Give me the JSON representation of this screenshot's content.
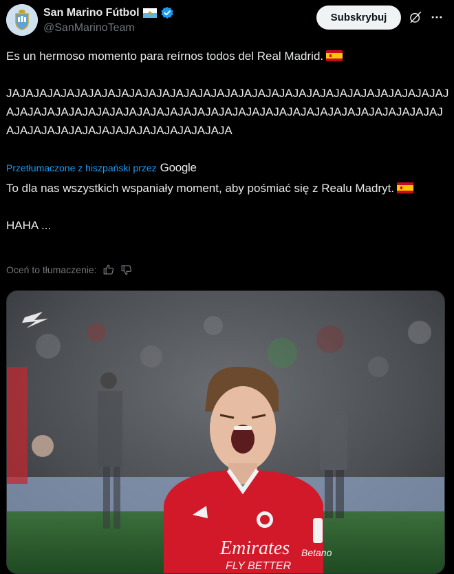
{
  "account": {
    "name": "San Marino Fútbol",
    "handle": "@SanMarinoTeam"
  },
  "header": {
    "subscribe_label": "Subskrybuj"
  },
  "icons": {
    "grok": "grok-icon",
    "more": "more-icon",
    "verified": "verified-badge-icon",
    "flag_san_marino": "flag-san-marino-icon",
    "flag_spain": "flag-spain-icon",
    "thumbs_up": "thumbs-up-icon",
    "thumbs_down": "thumbs-down-icon"
  },
  "tweet": {
    "line1": "Es un hermoso momento para reírnos todos del Real Madrid.",
    "laugh": "JAJAJAJAJAJAJAJAJAJAJAJAJAJAJAJAJAJAJAJAJAJAJAJAJAJAJAJAJAJAJAJAJAJAJAJAJAJAJAJAJAJAJAJAJAJAJAJAJAJAJAJAJAJAJAJAJAJAJAJAJAJAJAJAJAJAJAJAJAJAJAJAJAJAJAJAJAJAJAJAJA"
  },
  "translation_bar": {
    "prefix": "Przetłumaczone z hiszpański przez",
    "provider": "Google"
  },
  "translation": {
    "line1": "To dla nas wszystkich wspaniały moment, aby pośmiać się z Realu Madryt.",
    "line2": "HAHA ..."
  },
  "rate": {
    "label": "Oceń to tłumaczenie:"
  },
  "media": {
    "shirt_sponsor": "Emirates",
    "shirt_sponsor_sub": "FLY BETTER",
    "sleeve_text": "Betano"
  },
  "colors": {
    "background": "#000000",
    "text": "#e7e9ea",
    "muted": "#71767b",
    "link": "#1d9bf0",
    "verified": "#1d9bf0",
    "button_bg": "#eff3f4",
    "shirt_red": "#d1192a"
  }
}
